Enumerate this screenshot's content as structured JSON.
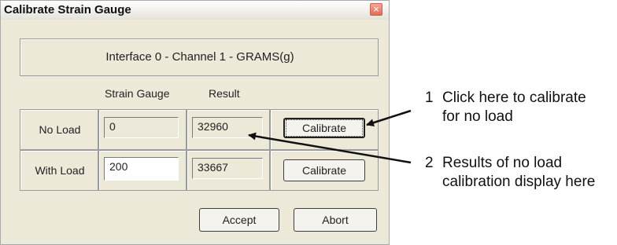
{
  "window": {
    "title": "Calibrate Strain Gauge",
    "close_glyph": "×"
  },
  "header": {
    "text": "Interface 0 - Channel 1 - GRAMS(g)"
  },
  "columns": {
    "strain_gauge": "Strain Gauge",
    "result": "Result"
  },
  "rows": [
    {
      "label": "No Load",
      "strain_gauge": "0",
      "result": "32960",
      "button": "Calibrate"
    },
    {
      "label": "With Load",
      "strain_gauge": "200",
      "result": "33667",
      "button": "Calibrate"
    }
  ],
  "footer": {
    "accept": "Accept",
    "abort": "Abort"
  },
  "annotations": [
    {
      "number": "1",
      "line1": "Click here to calibrate",
      "line2": "for no load"
    },
    {
      "number": "2",
      "line1": "Results of no load",
      "line2": "calibration display here"
    }
  ],
  "colors": {
    "dialog_bg": "#ece9d8",
    "close_button": "#e06c52",
    "input_bg": "#ffffff"
  }
}
